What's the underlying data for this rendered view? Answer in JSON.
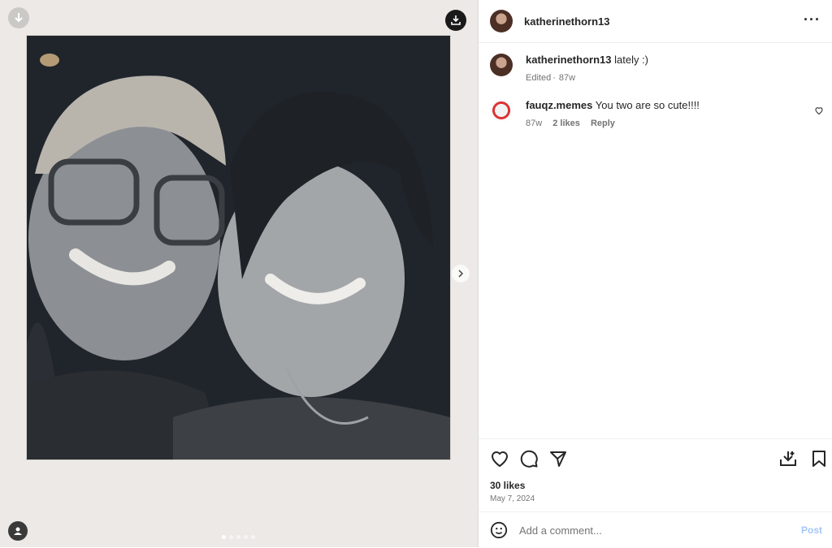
{
  "post": {
    "author": "katherinethorn13",
    "caption": "lately :)",
    "caption_meta_edited": "Edited",
    "caption_meta_time": "87w",
    "likes": "30 likes",
    "date": "May 7, 2024",
    "more_label": "···"
  },
  "comments": [
    {
      "user": "fauqz.memes",
      "text": "You two are so cute!!!!",
      "time": "87w",
      "likes": "2 likes",
      "reply": "Reply"
    }
  ],
  "composer": {
    "placeholder": "Add a comment...",
    "post_label": "Post"
  },
  "carousel": {
    "current": 1,
    "total": 5
  },
  "icons": {
    "download": "download-icon",
    "next": "chevron-right-icon",
    "user_tag": "user-tag-icon",
    "like": "heart-icon",
    "comment": "comment-icon",
    "share": "share-icon",
    "save_download": "download-save-icon",
    "bookmark": "bookmark-icon",
    "emoji": "emoji-icon"
  },
  "colors": {
    "post_button": "#a4c7f5",
    "text_primary": "#262626",
    "text_secondary": "#737373"
  }
}
